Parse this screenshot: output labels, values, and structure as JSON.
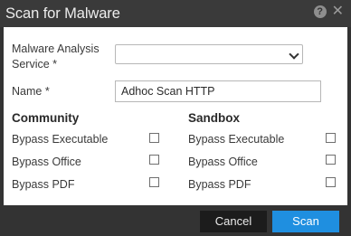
{
  "dialog": {
    "title": "Scan for Malware",
    "help_icon": "question-circle",
    "close_icon": "close-x",
    "help_glyph": "?",
    "close_glyph": "✕"
  },
  "form": {
    "service_label_line1": "Malware Analysis",
    "service_label_line2": "Service *",
    "service_value": "",
    "name_label": "Name *",
    "name_value": "Adhoc Scan HTTP"
  },
  "community": {
    "title": "Community",
    "options": [
      "Bypass Executable",
      "Bypass Office",
      "Bypass PDF"
    ],
    "checked": [
      false,
      false,
      false
    ]
  },
  "sandbox": {
    "title": "Sandbox",
    "options": [
      "Bypass Executable",
      "Bypass Office",
      "Bypass PDF"
    ],
    "checked": [
      false,
      false,
      false
    ]
  },
  "buttons": {
    "cancel_label": "Cancel",
    "scan_label": "Scan"
  },
  "colors": {
    "titlebar": "#3a3a3a",
    "primary": "#1f8fe0",
    "cancel": "#1c1c1c"
  }
}
